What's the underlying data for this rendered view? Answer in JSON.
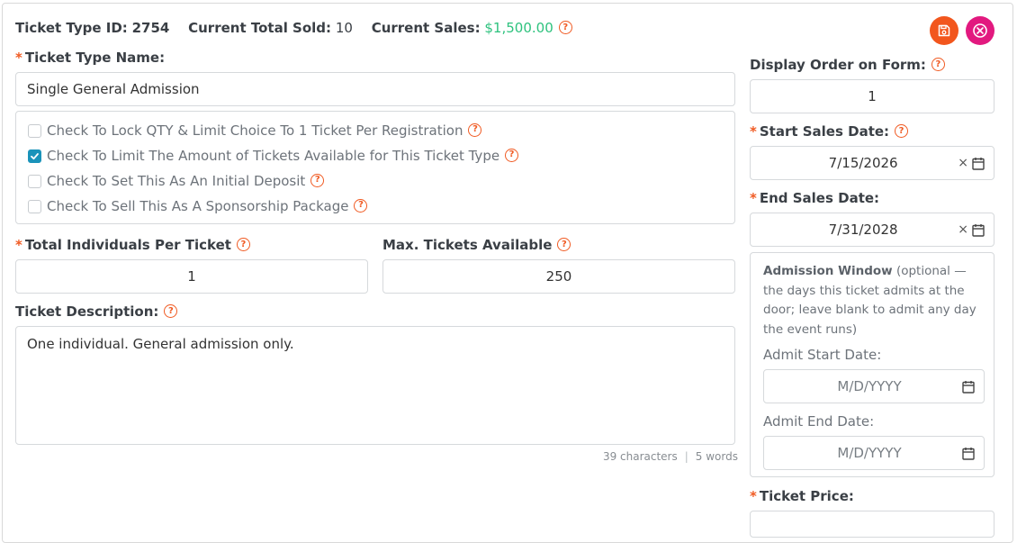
{
  "header": {
    "id_label": "Ticket Type ID:",
    "id_value": "2754",
    "sold_label": "Current Total Sold:",
    "sold_value": "10",
    "sales_label": "Current Sales:",
    "sales_value": "$1,500.00"
  },
  "colors": {
    "accent_orange": "#f2561d",
    "accent_pink": "#e2197f",
    "money_green": "#2ec27e",
    "checkbox_blue": "#1a93ba"
  },
  "icons": {
    "save": "save-icon",
    "close": "close-circle-icon",
    "help": "help-question-icon",
    "calendar": "calendar-icon"
  },
  "required_mark": "*",
  "help_glyph": "?",
  "ticket_name": {
    "label": "Ticket Type Name:",
    "value": "Single General Admission"
  },
  "options": [
    {
      "label": "Check To Lock QTY & Limit Choice To 1 Ticket Per Registration",
      "checked": false
    },
    {
      "label": "Check To Limit The Amount of Tickets Available for This Ticket Type",
      "checked": true
    },
    {
      "label": "Check To Set This As An Initial Deposit",
      "checked": false
    },
    {
      "label": "Check To Sell This As A Sponsorship Package",
      "checked": false
    }
  ],
  "individuals": {
    "label": "Total Individuals Per Ticket",
    "value": "1"
  },
  "max_tickets": {
    "label": "Max. Tickets Available",
    "value": "250"
  },
  "description": {
    "label": "Ticket Description:",
    "value": "One individual. General admission only.",
    "chars": "39 characters",
    "sep": "|",
    "words": "5 words"
  },
  "display_order": {
    "label": "Display Order on Form:",
    "value": "1"
  },
  "start_sales": {
    "label": "Start Sales Date:",
    "value": "7/15/2026",
    "clear": "×"
  },
  "end_sales": {
    "label": "End Sales Date:",
    "value": "7/31/2028",
    "clear": "×"
  },
  "admission_window": {
    "title": "Admission Window",
    "note": "(optional — the days this ticket admits at the door; leave blank to admit any day the event runs)",
    "start_label": "Admit Start Date:",
    "start_placeholder": "M/D/YYYY",
    "end_label": "Admit End Date:",
    "end_placeholder": "M/D/YYYY"
  },
  "ticket_price": {
    "label": "Ticket Price:"
  }
}
